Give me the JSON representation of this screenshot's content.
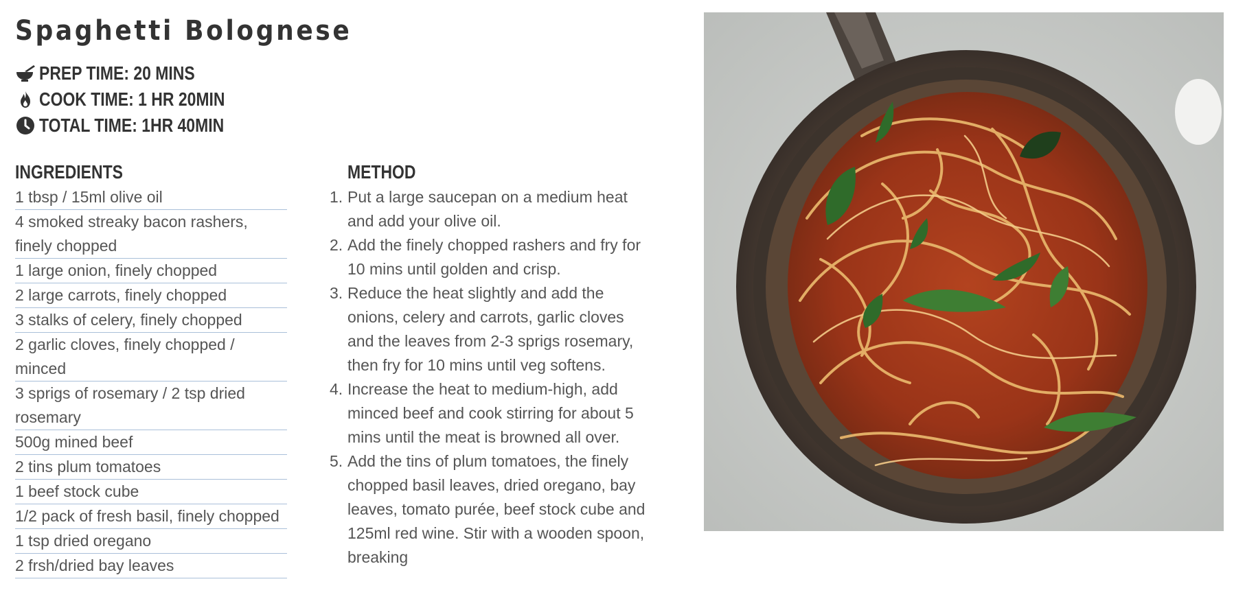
{
  "recipe": {
    "title": "Spaghetti Bolognese",
    "times": [
      {
        "icon": "mortar-bowl-icon",
        "label": "PREP TIME: 20 MINS"
      },
      {
        "icon": "flame-icon",
        "label": "COOK TIME: 1 HR 20MIN"
      },
      {
        "icon": "clock-icon",
        "label": "TOTAL TIME: 1HR 40MIN"
      }
    ],
    "ingredients_heading": "INGREDIENTS",
    "ingredients": [
      "1 tbsp / 15ml olive oil",
      "4 smoked streaky bacon rashers, finely chopped",
      "1 large onion, finely chopped",
      "2 large carrots, finely chopped",
      "3 stalks of celery, finely chopped",
      "2 garlic cloves, finely chopped / minced",
      "3 sprigs of rosemary / 2 tsp dried rosemary",
      "500g mined beef",
      "2 tins plum tomatoes",
      "1 beef stock cube",
      "1/2 pack of fresh basil, finely chopped",
      "1 tsp dried oregano",
      "2 frsh/dried bay leaves"
    ],
    "method_heading": "METHOD",
    "method": [
      {
        "num": "1.",
        "text": "Put a large saucepan on a medium heat and add your olive oil."
      },
      {
        "num": "2.",
        "text": "Add the finely chopped rashers and fry for 10 mins until golden and crisp."
      },
      {
        "num": "3.",
        "text": "Reduce the heat slightly and add the onions, celery and carrots, garlic cloves and the leaves from 2-3 sprigs rosemary, then fry for 10 mins until veg softens."
      },
      {
        "num": "4.",
        "text": "Increase the heat to medium-high, add minced beef and cook stirring for about 5 mins until the meat is browned all over."
      },
      {
        "num": "5.",
        "text": "Add the tins of plum tomatoes, the finely chopped basil leaves, dried oregano, bay leaves, tomato purée, beef stock cube and 125ml red wine. Stir with a wooden spoon, breaking"
      }
    ]
  },
  "colors": {
    "text_dark": "#333333",
    "text_body": "#555555",
    "rule_line": "#a9bfd9"
  }
}
